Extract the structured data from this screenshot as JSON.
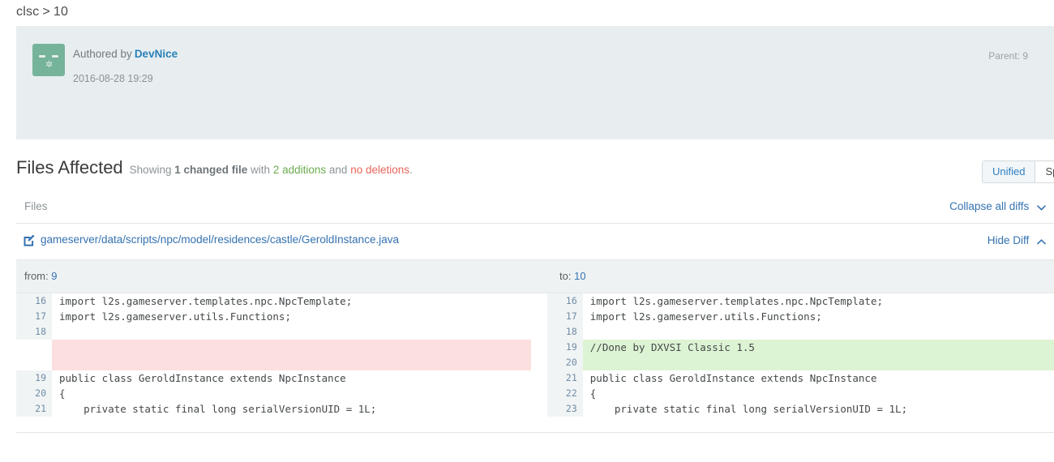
{
  "breadcrumb": {
    "repo": "clsc",
    "separator": ">",
    "revision": "10"
  },
  "commit": {
    "authored_label": "Authored by",
    "author": "DevNice",
    "date": "2016-08-28 19:29",
    "parent": "Parent: 9",
    "avatar_icon": "face-avatar-icon",
    "avatar_color": "#75b39b",
    "banner_color": "#e8eef0"
  },
  "files_affected": {
    "title": "Files Affected",
    "showing": "Showing",
    "changed_files": "1 changed file",
    "with": "with",
    "additions": "2 additions",
    "and": "and",
    "deletions": "no deletions",
    "period": ".",
    "addition_color": "#6aaa4f",
    "deletion_color": "#e8645a"
  },
  "view_toggle": {
    "options": [
      "Unified",
      "Split"
    ],
    "selected": "Unified",
    "active_color": "#2e7fc1"
  },
  "files_table": {
    "header_label": "Files",
    "collapse_all": "Collapse all diffs",
    "collapse_icon": "chevron-down-icon"
  },
  "file": {
    "icon": "file-edit-icon",
    "path": "gameserver/data/scripts/npc/model/residences/castle/GeroldInstance.java",
    "hide_diff": "Hide Diff",
    "hide_diff_icon": "chevron-up-icon",
    "link_color": "#3572b0"
  },
  "diff": {
    "from_label": "from:",
    "from_rev": "9",
    "to_label": "to:",
    "to_rev": "10",
    "add_bg": "#ddf4d4",
    "del_bg": "#fcdfdf",
    "left_lines": [
      {
        "num": "16",
        "text": "import l2s.gameserver.templates.npc.NpcTemplate;",
        "type": "context"
      },
      {
        "num": "17",
        "text": "import l2s.gameserver.utils.Functions;",
        "type": "context"
      },
      {
        "num": "18",
        "text": "",
        "type": "context"
      },
      {
        "num": "",
        "text": "",
        "type": "del-empty"
      },
      {
        "num": "",
        "text": "",
        "type": "del-empty"
      },
      {
        "num": "19",
        "text": "public class GeroldInstance extends NpcInstance",
        "type": "context"
      },
      {
        "num": "20",
        "text": "{",
        "type": "context"
      },
      {
        "num": "21",
        "text": "    private static final long serialVersionUID = 1L;",
        "type": "context"
      }
    ],
    "right_lines": [
      {
        "num": "16",
        "text": "import l2s.gameserver.templates.npc.NpcTemplate;",
        "type": "context"
      },
      {
        "num": "17",
        "text": "import l2s.gameserver.utils.Functions;",
        "type": "context"
      },
      {
        "num": "18",
        "text": "",
        "type": "context"
      },
      {
        "num": "19",
        "text": "//Done by DXVSI Classic 1.5",
        "type": "add"
      },
      {
        "num": "20",
        "text": "",
        "type": "add"
      },
      {
        "num": "21",
        "text": "public class GeroldInstance extends NpcInstance",
        "type": "context"
      },
      {
        "num": "22",
        "text": "{",
        "type": "context"
      },
      {
        "num": "23",
        "text": "    private static final long serialVersionUID = 1L;",
        "type": "context"
      }
    ]
  }
}
